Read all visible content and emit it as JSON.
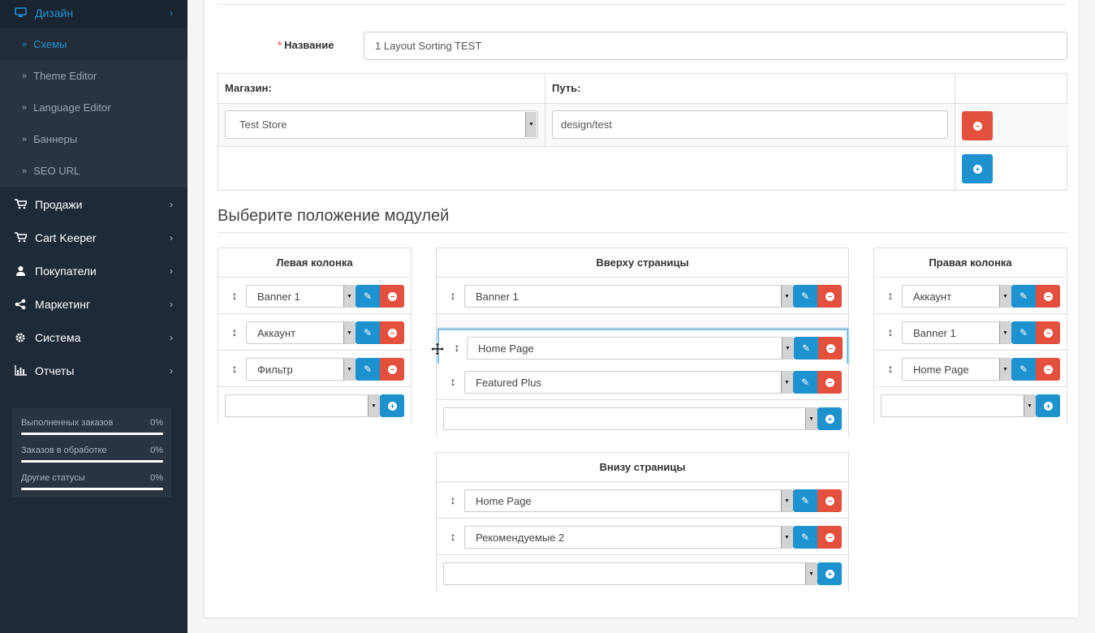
{
  "sidebar": {
    "active_section": "Дизайн",
    "submenu": [
      "Схемы",
      "Theme Editor",
      "Language Editor",
      "Баннеры",
      "SEO URL"
    ],
    "items": [
      "Продажи",
      "Cart Keeper",
      "Покупатели",
      "Маркетинг",
      "Система",
      "Отчеты"
    ],
    "stats": [
      {
        "label": "Выполненных заказов",
        "value": "0%"
      },
      {
        "label": "Заказов в обработке",
        "value": "0%"
      },
      {
        "label": "Другие статусы",
        "value": "0%"
      }
    ]
  },
  "form": {
    "name_label": "Название",
    "required_mark": "*",
    "name_value": "1 Layout Sorting TEST",
    "store_header": "Магазин:",
    "path_header": "Путь:",
    "store_value": "Test Store",
    "path_value": "design/test"
  },
  "modules": {
    "section_title": "Выберите положение модулей",
    "left": {
      "title": "Левая колонка",
      "items": [
        "Banner 1",
        "Аккаунт",
        "Фильтр"
      ]
    },
    "top": {
      "title": "Вверху страницы",
      "items": [
        "Banner 1",
        "Home Page",
        "Featured Plus"
      ]
    },
    "right": {
      "title": "Правая колонка",
      "items": [
        "Аккаунт",
        "Banner 1",
        "Home Page"
      ]
    },
    "bottom": {
      "title": "Внизу страницы",
      "items": [
        "Home Page",
        "Рекомендуемые 2"
      ]
    }
  },
  "colors": {
    "accent": "#1e91cf",
    "danger": "#e3503e",
    "sidebar": "#1f2a37"
  }
}
